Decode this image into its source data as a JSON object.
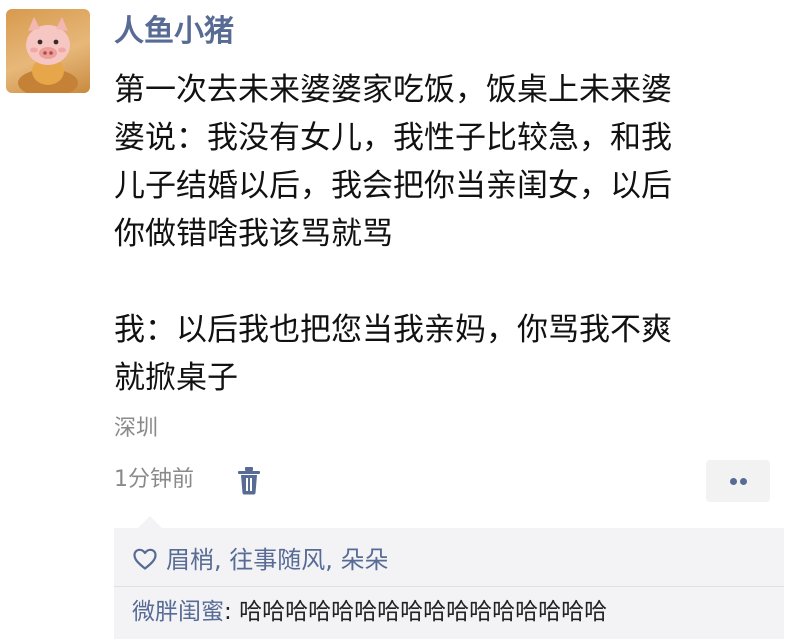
{
  "post": {
    "author": "人鱼小猪",
    "avatar_icon": "pig-avatar-icon",
    "content_lines": [
      "第一次去未来婆婆家吃饭，饭桌上未来婆",
      "婆说：我没有女儿，我性子比较急，和我",
      "儿子结婚以后，我会把你当亲闺女，以后",
      "你做错啥我该骂就骂",
      "我：以后我也把您当我亲妈，你骂我不爽",
      "就掀桌子"
    ],
    "location": "深圳",
    "time": "1分钟前",
    "delete_icon": "trash-icon",
    "more_icon": "more-dots-icon"
  },
  "likes": {
    "icon": "heart-icon",
    "names": [
      "眉梢",
      "往事随风",
      "朵朵"
    ],
    "separator": ", "
  },
  "comment": {
    "author": "微胖闺蜜",
    "colon": ": ",
    "text": "哈哈哈哈哈哈哈哈哈哈哈哈哈哈哈哈"
  },
  "colors": {
    "link_blue": "#576b95",
    "meta_gray": "#8a8a8a",
    "panel_bg": "#f3f3f5"
  }
}
